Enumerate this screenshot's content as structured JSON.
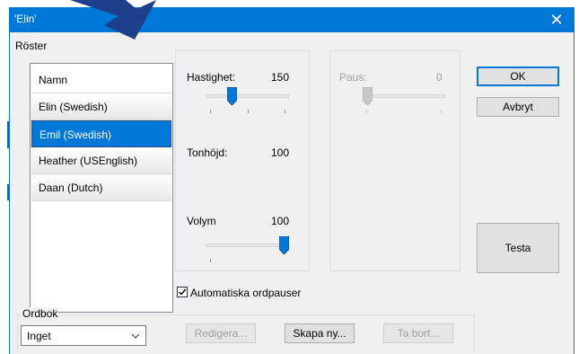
{
  "window": {
    "title": "'Elin'",
    "close_glyph": "✕"
  },
  "voices_group": {
    "label": "Röster"
  },
  "voice_list": {
    "header": "Namn",
    "items": [
      {
        "label": "Elin (Swedish)",
        "selected": false
      },
      {
        "label": "Emil (Swedish)",
        "selected": true
      },
      {
        "label": "Heather (USEnglish)",
        "selected": false
      },
      {
        "label": "Daan (Dutch)",
        "selected": false
      }
    ]
  },
  "speed": {
    "label": "Hastighet:",
    "value": "150",
    "level": 0.28
  },
  "pitch": {
    "label": "Tonhöjd:",
    "value": "100"
  },
  "volume": {
    "label": "Volym",
    "value": "100",
    "level": 1.0
  },
  "pause": {
    "label": "Paus:",
    "value": "0",
    "level": 0.0
  },
  "auto_pauses": {
    "label": "Automatiska ordpauser",
    "checked": true
  },
  "buttons": {
    "ok": "OK",
    "cancel": "Avbryt",
    "test": "Testa",
    "edit": "Redigera...",
    "create": "Skapa ny...",
    "delete": "Ta bort..."
  },
  "dictionary": {
    "label": "Ordbok",
    "selected": "Inget"
  },
  "colors": {
    "accent": "#0078d7",
    "selected_bg": "#0078d7",
    "disabled_text": "#a0a0a0",
    "arrow": "#1e3f8c"
  }
}
